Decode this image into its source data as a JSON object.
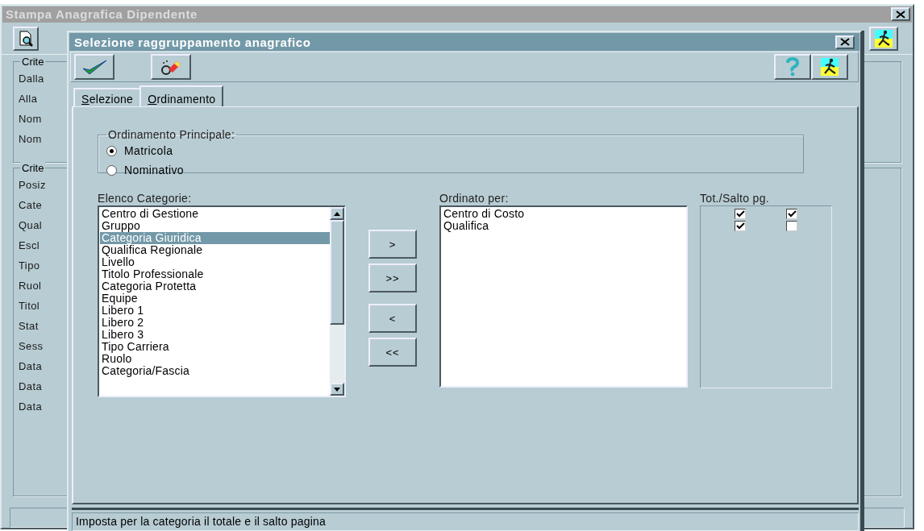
{
  "main_window": {
    "title": "Stampa Anagrafica Dipendente",
    "groups": [
      {
        "legend": "Crite",
        "labels": [
          "Dalla",
          "Alla",
          "Nom",
          "Nom"
        ]
      },
      {
        "legend": "Crite",
        "labels": [
          "Posiz",
          "Cate",
          "Qual",
          "Escl",
          "Tipo",
          "Ruol",
          "Titol",
          "Stat",
          "Sess",
          "Data",
          "Data",
          "Data"
        ]
      }
    ]
  },
  "dialog": {
    "title": "Selezione raggruppamento anagrafico",
    "tabs": [
      {
        "label": "Selezione",
        "selected": false
      },
      {
        "label": "Ordinamento",
        "selected": true
      }
    ],
    "main_order": {
      "legend": "Ordinamento Principale:",
      "options": [
        {
          "label": "Matricola",
          "selected": true
        },
        {
          "label": "Nominativo",
          "selected": false
        }
      ]
    },
    "categories": {
      "label": "Elenco Categorie:",
      "items": [
        {
          "label": "Centro di Gestione",
          "selected": false
        },
        {
          "label": "Gruppo",
          "selected": false
        },
        {
          "label": "Categoria Giuridica",
          "selected": true
        },
        {
          "label": "Qualifica Regionale",
          "selected": false
        },
        {
          "label": "Livello",
          "selected": false
        },
        {
          "label": "Titolo Professionale",
          "selected": false
        },
        {
          "label": "Categoria Protetta",
          "selected": false
        },
        {
          "label": "Equipe",
          "selected": false
        },
        {
          "label": "Libero 1",
          "selected": false
        },
        {
          "label": "Libero 2",
          "selected": false
        },
        {
          "label": "Libero 3",
          "selected": false
        },
        {
          "label": "Tipo Carriera",
          "selected": false
        },
        {
          "label": "Ruolo",
          "selected": false
        },
        {
          "label": "Categoria/Fascia",
          "selected": false
        }
      ]
    },
    "move_buttons": [
      ">",
      ">>",
      "<",
      "<<"
    ],
    "ordered_by": {
      "label": "Ordinato per:",
      "items": [
        "Centro di Costo",
        "Qualifica"
      ]
    },
    "totals": {
      "label": "Tot./Salto pg.",
      "rows": [
        {
          "total": true,
          "page_break": true
        },
        {
          "total": true,
          "page_break": false
        }
      ]
    },
    "status": "Imposta per la categoria il totale e il salto pagina"
  }
}
